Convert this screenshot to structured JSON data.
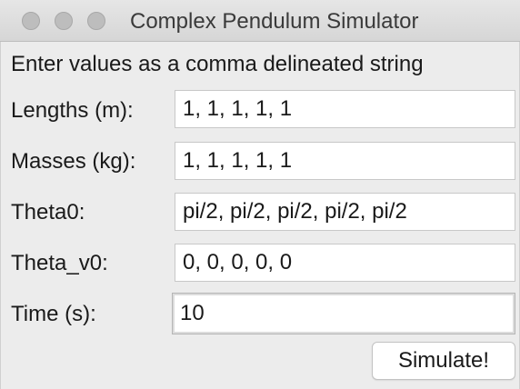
{
  "window": {
    "title": "Complex Pendulum Simulator"
  },
  "instructions": "Enter values as a comma delineated string",
  "fields": [
    {
      "label": "Lengths (m):",
      "value": "1, 1, 1, 1, 1"
    },
    {
      "label": "Masses (kg):",
      "value": "1, 1, 1, 1, 1"
    },
    {
      "label": "Theta0:",
      "value": "pi/2, pi/2, pi/2, pi/2, pi/2"
    },
    {
      "label": "Theta_v0:",
      "value": "0, 0, 0, 0, 0"
    },
    {
      "label": "Time (s):",
      "value": "10"
    }
  ],
  "simulate_button": {
    "label": "Simulate!"
  },
  "icons": {
    "close": "close-icon",
    "minimize": "minimize-icon",
    "zoom": "zoom-icon"
  }
}
